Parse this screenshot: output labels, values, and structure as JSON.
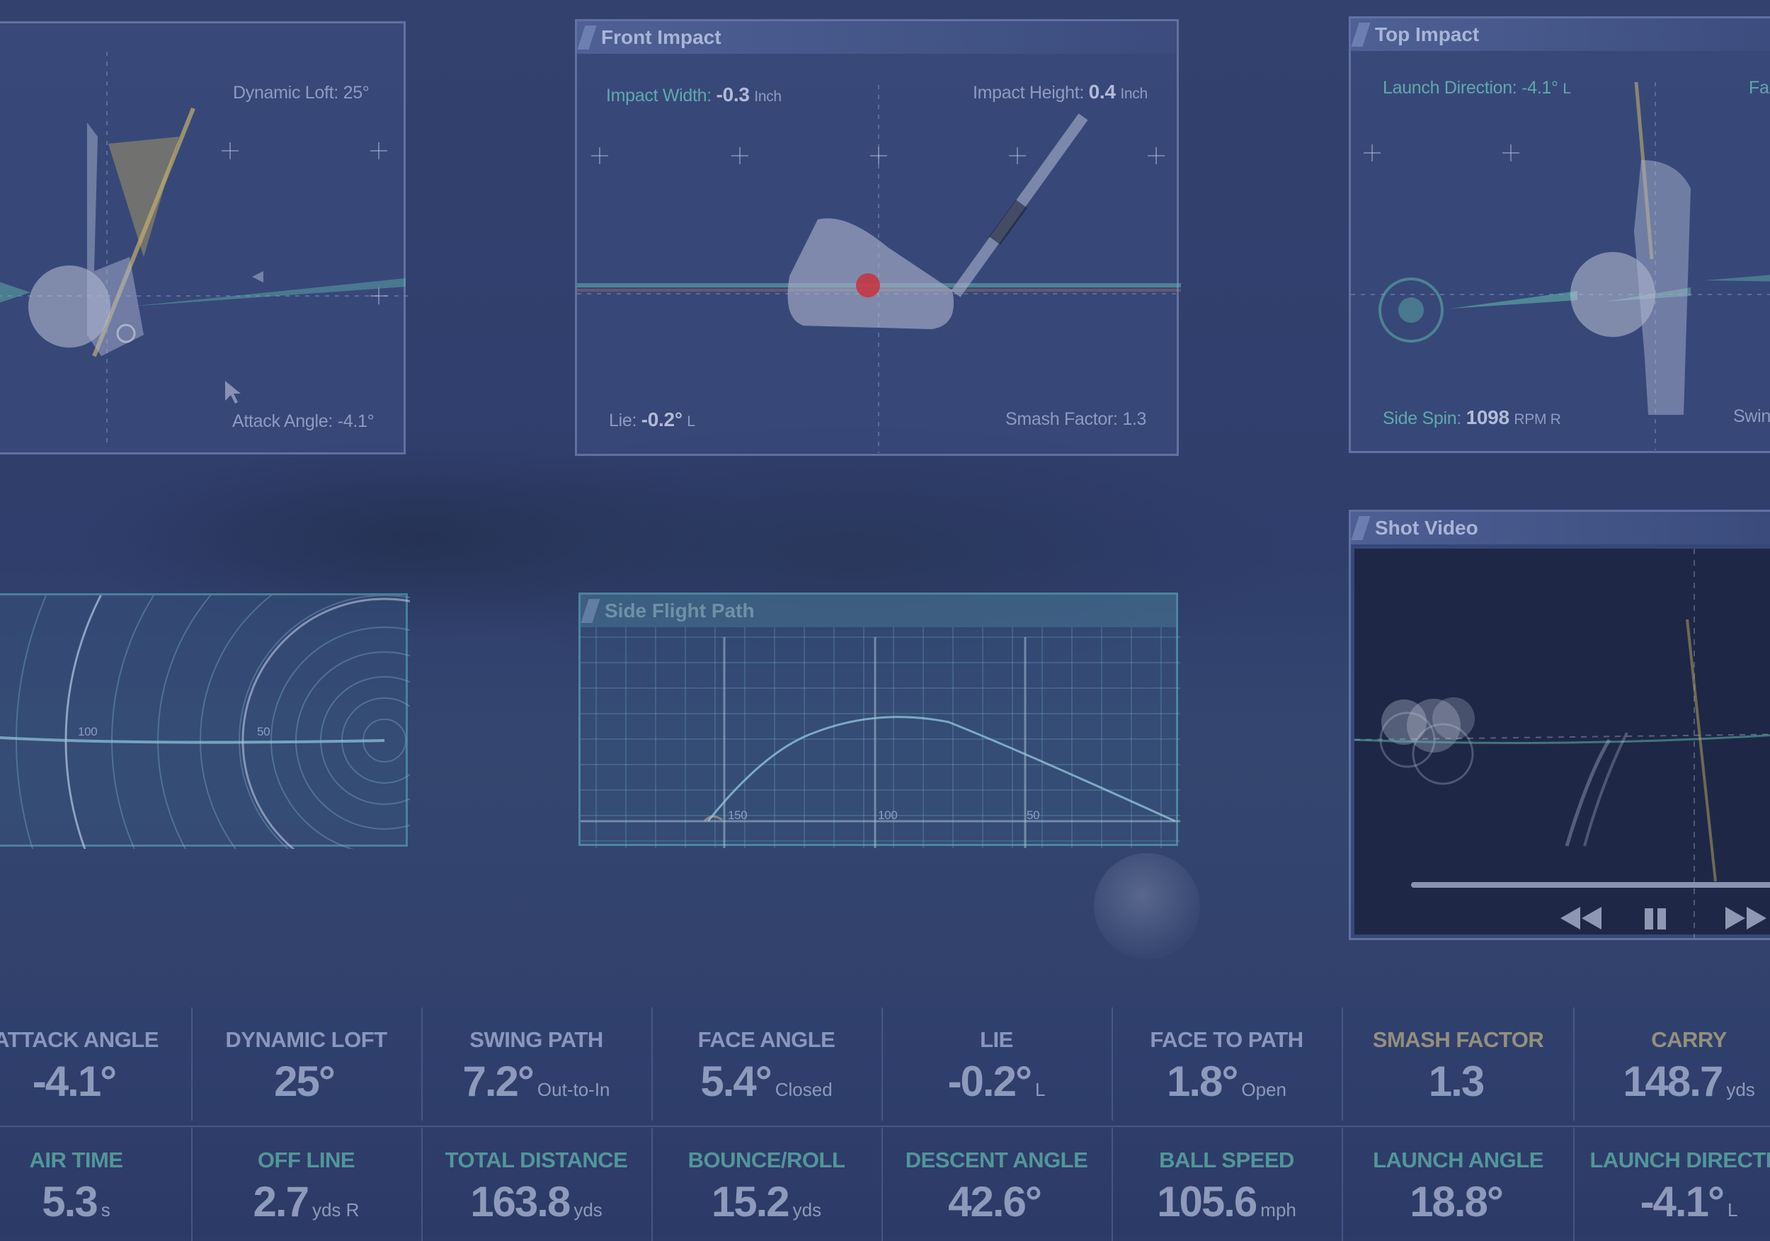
{
  "panels": {
    "side_impact": {
      "dynamic_loft_label": "Dynamic Loft:",
      "dynamic_loft_value": "25°",
      "attack_angle_label": "Attack Angle:",
      "attack_angle_value": "-4.1°"
    },
    "front_impact": {
      "title": "Front Impact",
      "impact_width_label": "Impact Width:",
      "impact_width_value": "-0.3",
      "impact_width_unit": "Inch",
      "impact_height_label": "Impact Height:",
      "impact_height_value": "0.4",
      "impact_height_unit": "Inch",
      "lie_label": "Lie:",
      "lie_value": "-0.2°",
      "lie_dir": "L",
      "smash_label": "Smash Factor:",
      "smash_value": "1.3"
    },
    "top_impact": {
      "title": "Top Impact",
      "launch_direction_label": "Launch Direction:",
      "launch_direction_value": "-4.1°",
      "launch_direction_dir": "L",
      "fa_label": "Fac",
      "side_spin_label": "Side Spin:",
      "side_spin_value": "1098",
      "side_spin_unit": "RPM R",
      "swing_label": "Swing"
    },
    "top_flight": {
      "tick_100": "100",
      "tick_50": "50"
    },
    "side_flight": {
      "title": "Side Flight Path",
      "tick_150": "150",
      "tick_100": "100",
      "tick_50": "50"
    },
    "shot_video": {
      "title": "Shot Video",
      "progress": 0.95
    }
  },
  "stats_row1": [
    {
      "name": "ATTACK ANGLE",
      "value": "-4.1°",
      "unit": ""
    },
    {
      "name": "DYNAMIC LOFT",
      "value": "25°",
      "unit": ""
    },
    {
      "name": "SWING PATH",
      "value": "7.2°",
      "unit": "Out-to-In"
    },
    {
      "name": "FACE ANGLE",
      "value": "5.4°",
      "unit": "Closed"
    },
    {
      "name": "LIE",
      "value": "-0.2°",
      "unit": "L"
    },
    {
      "name": "FACE TO PATH",
      "value": "1.8°",
      "unit": "Open"
    },
    {
      "name": "SMASH FACTOR",
      "value": "1.3",
      "unit": ""
    },
    {
      "name": "CARRY",
      "value": "148.7",
      "unit": "yds"
    }
  ],
  "stats_row2": [
    {
      "name": "AIR TIME",
      "value": "5.3",
      "unit": "s"
    },
    {
      "name": "OFF LINE",
      "value": "2.7",
      "unit": "yds R"
    },
    {
      "name": "TOTAL DISTANCE",
      "value": "163.8",
      "unit": "yds"
    },
    {
      "name": "BOUNCE/ROLL",
      "value": "15.2",
      "unit": "yds"
    },
    {
      "name": "DESCENT ANGLE",
      "value": "42.6°",
      "unit": ""
    },
    {
      "name": "BALL SPEED",
      "value": "105.6",
      "unit": "mph"
    },
    {
      "name": "LAUNCH ANGLE",
      "value": "18.8°",
      "unit": ""
    },
    {
      "name": "LAUNCH DIRECTIO",
      "value": "-4.1°",
      "unit": "L"
    }
  ],
  "colors": {
    "accent_teal": "#5fb4aa",
    "impact_red": "#c8323c",
    "club_gold": "#b9a564"
  }
}
